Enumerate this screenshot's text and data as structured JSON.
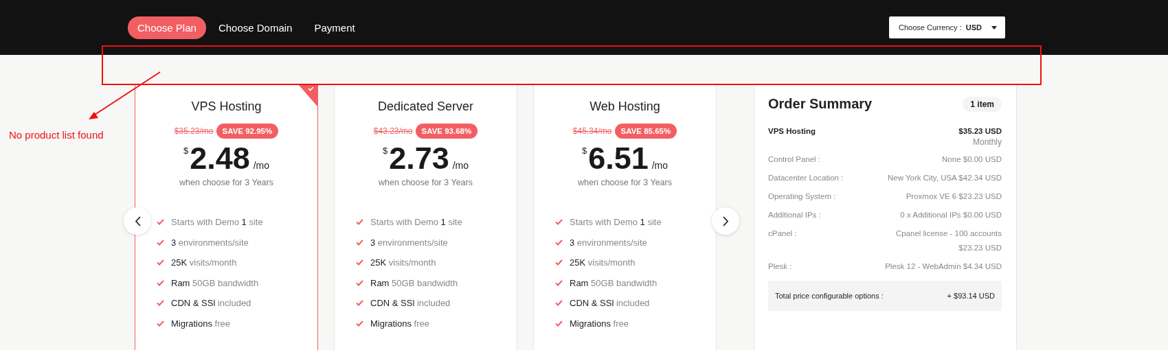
{
  "nav": {
    "steps": [
      {
        "label": "Choose Plan",
        "selected": true
      },
      {
        "label": "Choose Domain",
        "selected": false
      },
      {
        "label": "Payment",
        "selected": false
      }
    ],
    "currency": {
      "label": "Choose Currency :",
      "value": "USD"
    }
  },
  "plans": [
    {
      "name": "VPS Hosting",
      "selected": true,
      "old_price": "$35.23/mo",
      "save": "SAVE 92.95%",
      "currency": "$",
      "price": "2.48",
      "unit": "/mo",
      "term": "when choose for 3 Years",
      "features": [
        "Starts with Demo **1** site",
        "**3** environments/site",
        "**25K** visits/month",
        "**Ram** 50GB bandwidth",
        "**CDN & SSl** included",
        "**Migrations** free"
      ]
    },
    {
      "name": "Dedicated Server",
      "selected": false,
      "old_price": "$43.23/mo",
      "save": "SAVE 93.68%",
      "currency": "$",
      "price": "2.73",
      "unit": "/mo",
      "term": "when choose for 3 Years",
      "features": [
        "Starts with Demo **1** site",
        "**3** environments/site",
        "**25K** visits/month",
        "**Ram** 50GB bandwidth",
        "**CDN & SSl** included",
        "**Migrations** free"
      ]
    },
    {
      "name": "Web Hosting",
      "selected": false,
      "old_price": "$45.34/mo",
      "save": "SAVE 85.65%",
      "currency": "$",
      "price": "6.51",
      "unit": "/mo",
      "term": "when choose for 3 Years",
      "features": [
        "Starts with Demo **1** site",
        "**3** environments/site",
        "**25K** visits/month",
        "**Ram** 50GB bandwidth",
        "**CDN & SSl** included",
        "**Migrations** free"
      ]
    }
  ],
  "summary": {
    "title": "Order Summary",
    "count": "1 item",
    "product": {
      "name": "VPS Hosting",
      "price": "$35.23 USD",
      "cycle": "Monthly"
    },
    "options": [
      {
        "label": "Control Panel :",
        "value": "None $0.00 USD"
      },
      {
        "label": "Datacenter Location :",
        "value": "New York City, USA $42.34 USD"
      },
      {
        "label": "Operating System :",
        "value": "Proxmox VE 6 $23.23 USD"
      },
      {
        "label": "Additional IPs :",
        "value": "0 x Additional IPs $0.00 USD"
      },
      {
        "label": "cPanel :",
        "value": "Cpanel license - 100 accounts $23.23 USD"
      },
      {
        "label": "Plesk :",
        "value": "Plesk 12 - WebAdmin $4.34 USD"
      }
    ],
    "total": {
      "label": "Total price configurable options :",
      "value": "+ $93.14 USD"
    }
  },
  "annotation": {
    "note": "No product list found"
  }
}
